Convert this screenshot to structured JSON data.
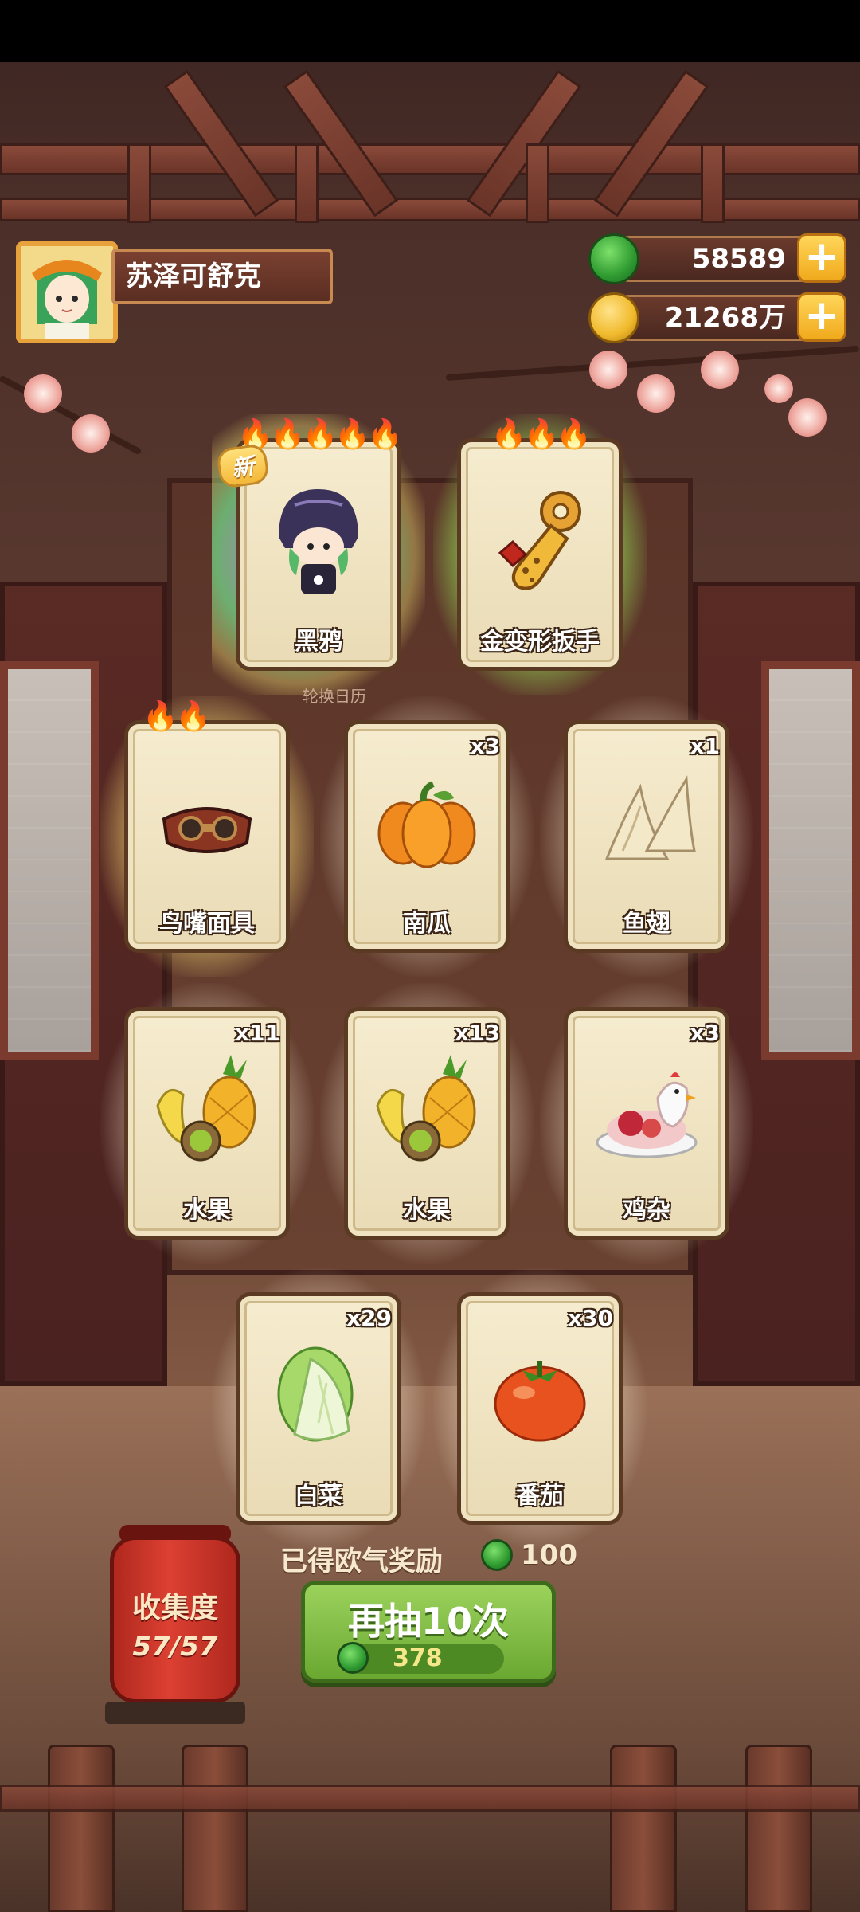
{
  "player": {
    "name": "苏泽可舒克"
  },
  "currencies": {
    "jade": {
      "value": "58589",
      "icon": "jade-coin-icon",
      "color": "#3fae3a"
    },
    "gold": {
      "value": "21268万",
      "icon": "gold-coin-icon",
      "color": "#f0b92b"
    }
  },
  "top_cards": [
    {
      "name": "黑鸦",
      "flames": 5,
      "is_new": true,
      "new_label": "新",
      "glow": "rainbow",
      "icon": "crow-character-icon"
    },
    {
      "name": "金变形扳手",
      "flames": 3,
      "is_new": false,
      "glow": "green",
      "icon": "golden-wrench-icon"
    }
  ],
  "background_sign": "轮换日历",
  "cards": [
    {
      "name": "鸟嘴面具",
      "qty": "",
      "flames": 2,
      "glow": "gold",
      "icon": "beak-mask-icon"
    },
    {
      "name": "南瓜",
      "qty": "x3",
      "glow": "white",
      "icon": "pumpkin-icon"
    },
    {
      "name": "鱼翅",
      "qty": "x1",
      "glow": "white",
      "icon": "shark-fin-icon"
    },
    {
      "name": "水果",
      "qty": "x11",
      "glow": "white",
      "icon": "fruit-basket-icon"
    },
    {
      "name": "水果",
      "qty": "x13",
      "glow": "white",
      "icon": "fruit-basket-icon"
    },
    {
      "name": "鸡杂",
      "qty": "x3",
      "glow": "white",
      "icon": "chicken-giblets-icon"
    },
    {
      "name": "白菜",
      "qty": "x29",
      "glow": "white",
      "icon": "cabbage-icon"
    },
    {
      "name": "番茄",
      "qty": "x30",
      "glow": "white",
      "icon": "tomato-icon"
    }
  ],
  "luck_bonus": {
    "label": "已得欧气奖励",
    "value": "100"
  },
  "collection": {
    "label": "收集度",
    "value": "57/57"
  },
  "draw_button": {
    "label": "再抽10次",
    "cost": "378"
  }
}
